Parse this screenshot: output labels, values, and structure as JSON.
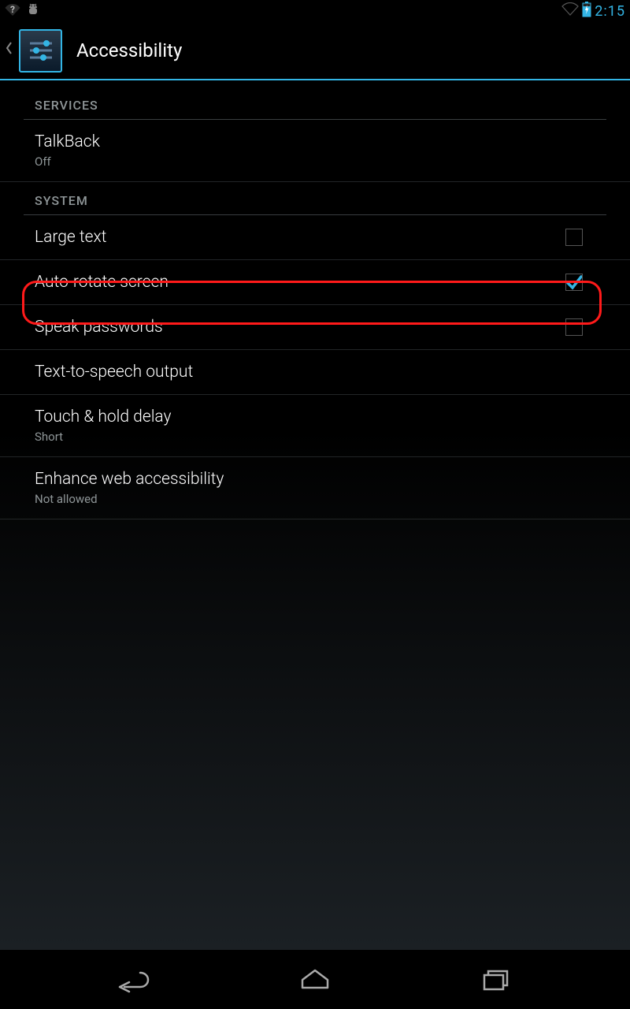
{
  "statusbar": {
    "time": "2:15"
  },
  "actionbar": {
    "title": "Accessibility"
  },
  "sections": {
    "services": {
      "header": "SERVICES",
      "items": [
        {
          "title": "TalkBack",
          "sub": "Off"
        }
      ]
    },
    "system": {
      "header": "SYSTEM",
      "items": [
        {
          "title": "Large text",
          "checked": false
        },
        {
          "title": "Auto-rotate screen",
          "checked": true
        },
        {
          "title": "Speak passwords",
          "checked": false
        },
        {
          "title": "Text-to-speech output"
        },
        {
          "title": "Touch & hold delay",
          "sub": "Short"
        },
        {
          "title": "Enhance web accessibility",
          "sub": "Not allowed"
        }
      ]
    }
  }
}
